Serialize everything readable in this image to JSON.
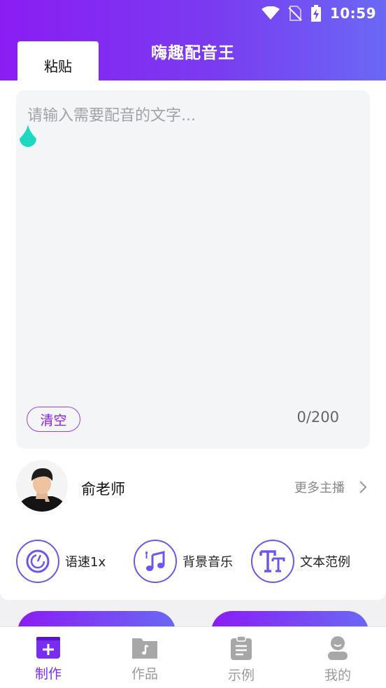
{
  "status_bar": {
    "time": "10:59",
    "icons": [
      "wifi-icon",
      "no-sim-icon",
      "battery-charging-icon"
    ]
  },
  "header": {
    "title": "嗨趣配音王",
    "paste_tab": "粘贴"
  },
  "editor": {
    "placeholder": "请输入需要配音的文字...",
    "clear_label": "清空",
    "counter": "0/200"
  },
  "anchor": {
    "name": "俞老师",
    "more_label": "更多主播"
  },
  "options": [
    {
      "label": "语速1x",
      "icon": "speed-gauge-icon"
    },
    {
      "label": "背景音乐",
      "icon": "music-note-icon"
    },
    {
      "label": "文本范例",
      "icon": "text-tt-icon"
    }
  ],
  "nav": [
    {
      "label": "制作",
      "icon": "create-icon",
      "active": true
    },
    {
      "label": "作品",
      "icon": "folder-icon",
      "active": false
    },
    {
      "label": "示例",
      "icon": "clipboard-icon",
      "active": false
    },
    {
      "label": "我的",
      "icon": "user-icon",
      "active": false
    }
  ],
  "colors": {
    "accent": "#8a1df3",
    "accent_end": "#6a68f5",
    "handle": "#1ed8c4"
  }
}
